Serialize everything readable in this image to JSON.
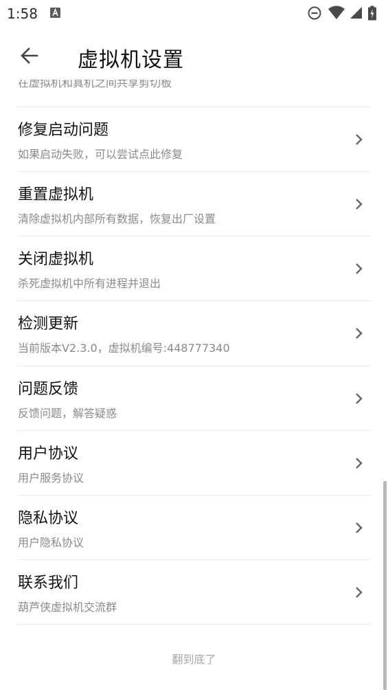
{
  "status_bar": {
    "time": "1:58",
    "icons": [
      "a-notification-icon",
      "do-not-disturb-icon",
      "wifi-icon",
      "cell-signal-icon",
      "battery-charging-icon"
    ]
  },
  "app_bar": {
    "back_icon": "arrow-left-icon",
    "title": "虚拟机设置"
  },
  "list": {
    "cut_row_subtitle": "在虚拟机和真机之间共享剪切板",
    "items": [
      {
        "title": "修复启动问题",
        "subtitle": "如果启动失败，可以尝试点此修复"
      },
      {
        "title": "重置虚拟机",
        "subtitle": "清除虚拟机内部所有数据，恢复出厂设置"
      },
      {
        "title": "关闭虚拟机",
        "subtitle": "杀死虚拟机中所有进程并退出"
      },
      {
        "title": "检测更新",
        "subtitle": "当前版本V2.3.0，虚拟机编号:448777340"
      },
      {
        "title": "问题反馈",
        "subtitle": "反馈问题，解答疑惑"
      },
      {
        "title": "用户协议",
        "subtitle": "用户服务协议"
      },
      {
        "title": "隐私协议",
        "subtitle": "用户隐私协议"
      },
      {
        "title": "联系我们",
        "subtitle": "葫芦侠虚拟机交流群"
      }
    ],
    "footer": "翻到底了"
  },
  "colors": {
    "title_text": "#111111",
    "subtitle_text": "#8a8a8a",
    "divider": "#ececec",
    "chevron": "#6b6b6b",
    "footer_text": "#a8a8a8",
    "scrollbar": "#b9b9b9"
  }
}
